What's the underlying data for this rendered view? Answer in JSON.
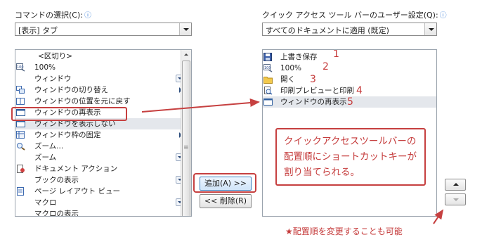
{
  "left": {
    "label": "コマンドの選択(C):",
    "combo_value": "[表示] タブ",
    "items": [
      {
        "label": "<区切り>",
        "icon": "",
        "suffix": ""
      },
      {
        "label": "100%",
        "icon": "zoom-100-icon",
        "suffix": ""
      },
      {
        "label": "ウィンドウ",
        "icon": "",
        "suffix": "submenu"
      },
      {
        "label": "ウィンドウの切り替え",
        "icon": "switch-windows-icon",
        "suffix": "arrow"
      },
      {
        "label": "ウィンドウの位置を元に戻す",
        "icon": "reset-window-icon",
        "suffix": ""
      },
      {
        "label": "ウィンドウの再表示",
        "icon": "window-icon",
        "suffix": ""
      },
      {
        "label": "ウィンドウを表示しない",
        "icon": "window-icon",
        "suffix": ""
      },
      {
        "label": "ウィンドウ枠の固定",
        "icon": "freeze-panes-icon",
        "suffix": "arrow"
      },
      {
        "label": "ズーム...",
        "icon": "magnifier-icon",
        "suffix": ""
      },
      {
        "label": "ズーム",
        "icon": "",
        "suffix": "submenu"
      },
      {
        "label": "ドキュメント アクション",
        "icon": "document-action-icon",
        "suffix": ""
      },
      {
        "label": "ブックの表示",
        "icon": "",
        "suffix": "submenu"
      },
      {
        "label": "ページ レイアウト ビュー",
        "icon": "page-layout-icon",
        "suffix": ""
      },
      {
        "label": "マクロ",
        "icon": "",
        "suffix": "submenu"
      },
      {
        "label": "マクロの表示",
        "icon": "",
        "suffix": ""
      }
    ]
  },
  "right": {
    "label": "クイック アクセス ツール バーのユーザー設定(Q):",
    "combo_value": "すべてのドキュメントに適用 (既定)",
    "items": [
      {
        "label": "上書き保存",
        "icon": "save-icon",
        "number": "1"
      },
      {
        "label": "100%",
        "icon": "zoom-100-icon",
        "number": "2"
      },
      {
        "label": "開く",
        "icon": "folder-icon",
        "number": "3"
      },
      {
        "label": "印刷プレビューと印刷",
        "icon": "print-preview-icon",
        "number": "4"
      },
      {
        "label": "ウィンドウの再表示",
        "icon": "window-icon",
        "number": "5"
      }
    ]
  },
  "buttons": {
    "add": "追加(A) >>",
    "remove": "<< 削除(R)"
  },
  "annotation": {
    "text": "クイックアクセスツールバーの配置順にショートカットキーが割り当てられる。",
    "note": "★配置順を変更することも可能"
  },
  "colors": {
    "annotation": "#c53b3b",
    "selected_row": "#e4e7ec",
    "info": "#3c7fd8"
  }
}
